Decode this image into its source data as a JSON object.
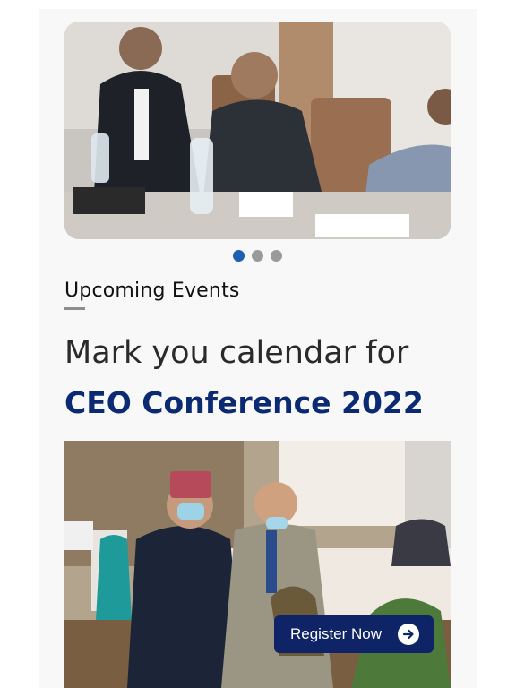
{
  "carousel": {
    "slide_count": 3,
    "active_index": 0
  },
  "section": {
    "label": "Upcoming Events"
  },
  "headline": "Mark you calendar for",
  "event": {
    "title": "CEO Conference 2022"
  },
  "register": {
    "label": "Register Now",
    "icon": "arrow-right-circle-icon"
  },
  "colors": {
    "accent": "#1d5fb0",
    "title": "#0c2a73",
    "button": "#0e2466"
  }
}
